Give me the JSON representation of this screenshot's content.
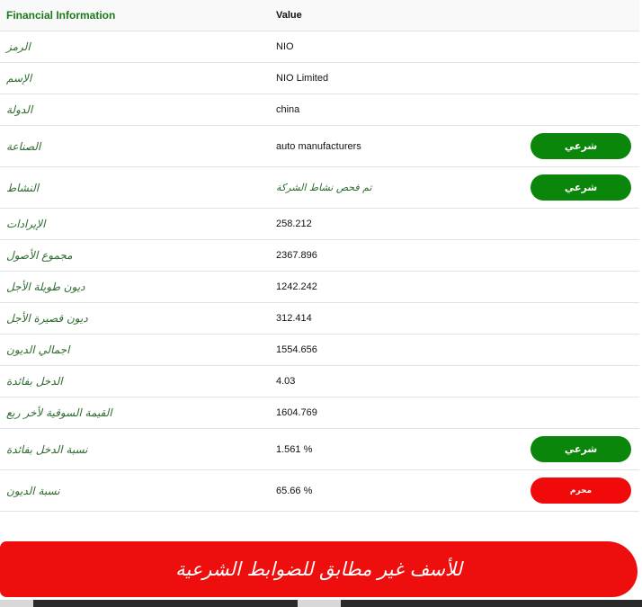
{
  "header": {
    "label": "Financial Information",
    "value": "Value"
  },
  "rows": [
    {
      "label": "الرمز",
      "value": "NIO",
      "pill": null
    },
    {
      "label": "الإسم",
      "value": "NIO Limited",
      "pill": null
    },
    {
      "label": "الدولة",
      "value": "china",
      "pill": null
    },
    {
      "label": "الصناعة",
      "value": "auto manufacturers",
      "pill": {
        "text": "شرعي",
        "color": "#0a870a"
      }
    },
    {
      "label": "النشاط",
      "value": "تم فحص نشاط الشركة",
      "pill": {
        "text": "شرعي",
        "color": "#0a870a"
      }
    },
    {
      "label": "الإيرادات",
      "value": "258.212",
      "pill": null
    },
    {
      "label": "مجموع الأصول",
      "value": "2367.896",
      "pill": null
    },
    {
      "label": "ديون طويلة الأجل",
      "value": "1242.242",
      "pill": null
    },
    {
      "label": "ديون قصيرة الأجل",
      "value": "312.414",
      "pill": null
    },
    {
      "label": "اجمالي الديون",
      "value": "1554.656",
      "pill": null
    },
    {
      "label": "الدخل بفائدة",
      "value": "4.03",
      "pill": null
    },
    {
      "label": "القيمة السوقية لأخر ربع",
      "value": "1604.769",
      "pill": null
    },
    {
      "label": "نسبة الدخل بفائدة",
      "value": "1.561 %",
      "pill": {
        "text": "شرعي",
        "color": "#0a870a"
      }
    },
    {
      "label": "نسبة الديون",
      "value": "65.66 %",
      "pill": {
        "text": "محرم",
        "color": "#f00a0a"
      }
    }
  ],
  "banner": {
    "text": "للأسف غير مطابق للضوابط الشرعية",
    "color": "#ee0e0e"
  }
}
